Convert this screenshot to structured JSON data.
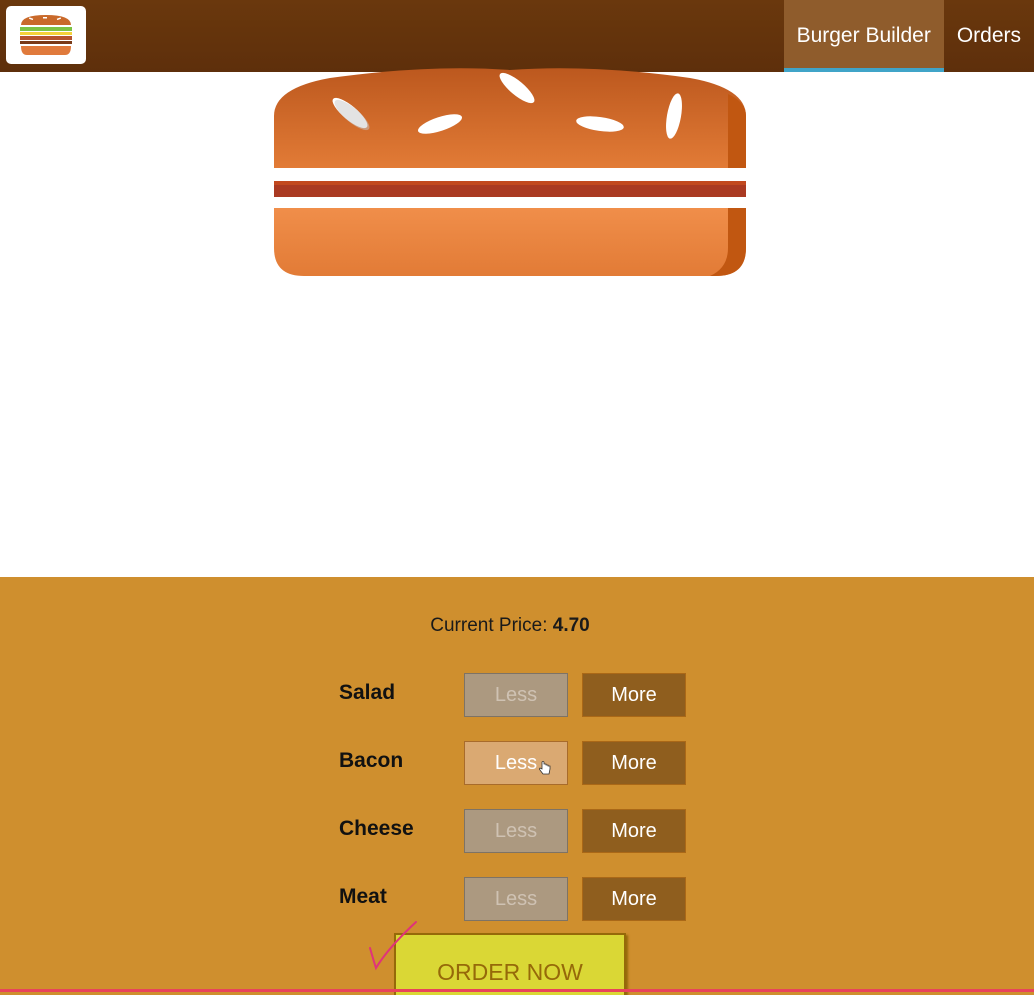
{
  "toolbar": {
    "logo_icon": "burger-logo-icon",
    "nav": [
      {
        "label": "Burger Builder",
        "active": true
      },
      {
        "label": "Orders",
        "active": false
      }
    ],
    "colors": {
      "background": "#703B09",
      "active_item": "#8F5C2C",
      "active_underline": "#40A4C8"
    }
  },
  "burger": {
    "ingredients": [],
    "icon": "burger-bread-icon"
  },
  "build_controls": {
    "price_label": "Current Price:",
    "price_value": "4.70",
    "controls": [
      {
        "label": "Salad",
        "less": "Less",
        "more": "More",
        "less_disabled": true
      },
      {
        "label": "Bacon",
        "less": "Less",
        "more": "More",
        "less_disabled": false
      },
      {
        "label": "Cheese",
        "less": "Less",
        "more": "More",
        "less_disabled": true
      },
      {
        "label": "Meat",
        "less": "Less",
        "more": "More",
        "less_disabled": true
      }
    ],
    "order_button": "ORDER NOW",
    "colors": {
      "background": "#CF8F2E",
      "order_button": "#DAD735"
    }
  }
}
